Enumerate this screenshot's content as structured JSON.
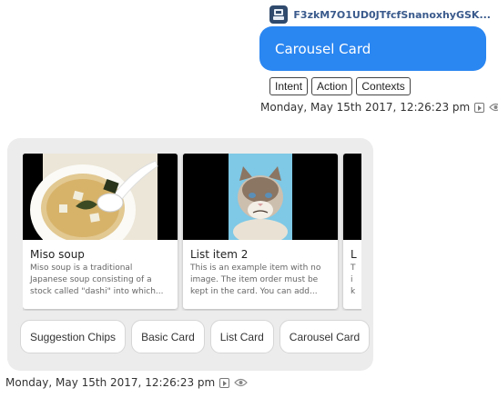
{
  "header": {
    "user_name": "F3zkM7O1UD0JTfcfSnanoxhyGSK..."
  },
  "user_message": {
    "text": "Carousel Card",
    "tags": [
      "Intent",
      "Action",
      "Contexts"
    ],
    "timestamp": "Monday, May 15th 2017, 12:26:23 pm"
  },
  "bot_message": {
    "cards": [
      {
        "title": "Miso soup",
        "description": "Miso soup is a traditional Japanese soup consisting of a stock called \"dashi\" into which..."
      },
      {
        "title": "List item 2",
        "description": "This is an example item with no image. The item order must be kept in the card. You can add..."
      },
      {
        "title": "L",
        "description": "T i k"
      }
    ],
    "suggestions": [
      "Suggestion Chips",
      "Basic Card",
      "List Card",
      "Carousel Card"
    ],
    "timestamp": "Monday, May 15th 2017, 12:26:23 pm"
  },
  "colors": {
    "user_bubble": "#2a86f1",
    "panel_bg": "#ececec",
    "username": "#3a5a8c"
  },
  "icons": [
    "user-avatar-icon",
    "play-icon",
    "eye-icon"
  ]
}
